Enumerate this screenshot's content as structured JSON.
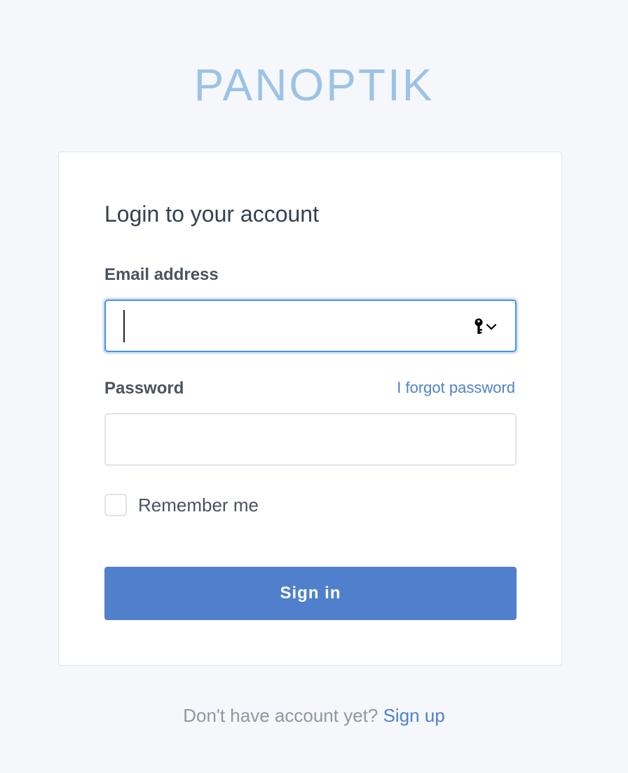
{
  "brand": {
    "logo_text": "PANOPTIK",
    "logo_color": "#9cc3e6"
  },
  "login_card": {
    "title": "Login to your account",
    "email": {
      "label": "Email address",
      "value": "",
      "placeholder": "",
      "focused": true,
      "autofill_icon": "key-icon"
    },
    "password": {
      "label": "Password",
      "value": "",
      "placeholder": "",
      "forgot_link": "I forgot password"
    },
    "remember_me": {
      "label": "Remember me",
      "checked": false
    },
    "submit": {
      "label": "Sign in",
      "color": "#5080cb"
    }
  },
  "footer": {
    "prompt": "Don't have account yet?",
    "signup_link": "Sign up"
  },
  "colors": {
    "background": "#f5f7fb",
    "accent": "#4f82c9",
    "focus_border": "#4a90e2"
  }
}
